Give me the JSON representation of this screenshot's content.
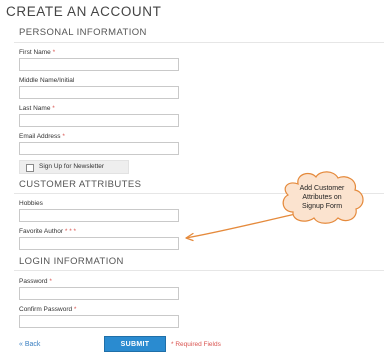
{
  "page": {
    "title": "CREATE AN ACCOUNT"
  },
  "sections": {
    "personal": "PERSONAL INFORMATION",
    "customer": "CUSTOMER ATTRIBUTES",
    "login": "LOGIN INFORMATION"
  },
  "fields": {
    "first_name": {
      "label": "First Name",
      "required_mark": "*"
    },
    "middle_name": {
      "label": "Middle Name/Initial"
    },
    "last_name": {
      "label": "Last Name",
      "required_mark": "*"
    },
    "email": {
      "label": "Email Address",
      "required_mark": "*"
    },
    "newsletter": {
      "label": "Sign Up for Newsletter",
      "checked": false
    },
    "hobbies": {
      "label": "Hobbies"
    },
    "favorite_author": {
      "label": "Favorite Author",
      "required_mark": "* * *"
    },
    "password": {
      "label": "Password",
      "required_mark": "*"
    },
    "confirm_password": {
      "label": "Confirm Password",
      "required_mark": "*"
    }
  },
  "actions": {
    "back_label": "« Back",
    "submit_label": "SUBMIT",
    "required_note": "* Required Fields"
  },
  "callout": {
    "line1": "Add Customer",
    "line2": "Attributes on",
    "line3": "Signup Form"
  },
  "colors": {
    "accent": "#2a8bd0",
    "required": "#d9534f",
    "link": "#3a7fc1",
    "callout_fill": "#fbe3cf",
    "callout_stroke": "#e58a3c"
  }
}
